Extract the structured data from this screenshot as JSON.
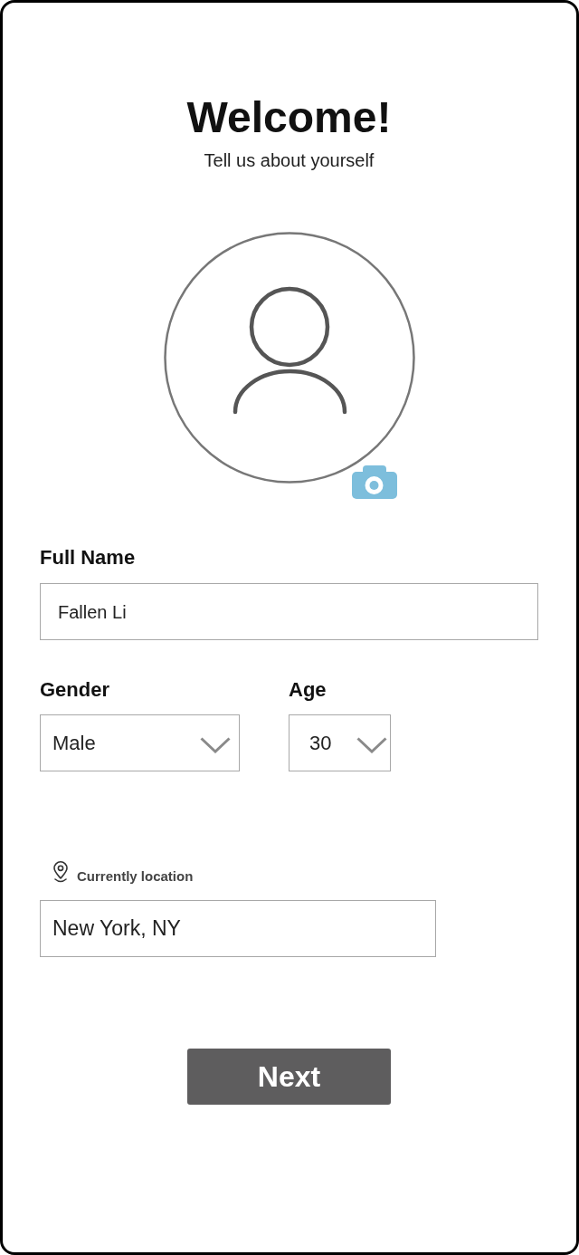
{
  "header": {
    "title": "Welcome!",
    "subtitle": "Tell us about yourself"
  },
  "full_name": {
    "label": "Full Name",
    "value": "Fallen Li"
  },
  "gender": {
    "label": "Gender",
    "value": "Male"
  },
  "age": {
    "label": "Age",
    "value": "30"
  },
  "location": {
    "label": "Currently location",
    "value": "New York, NY"
  },
  "next_button": {
    "label": "Next"
  }
}
